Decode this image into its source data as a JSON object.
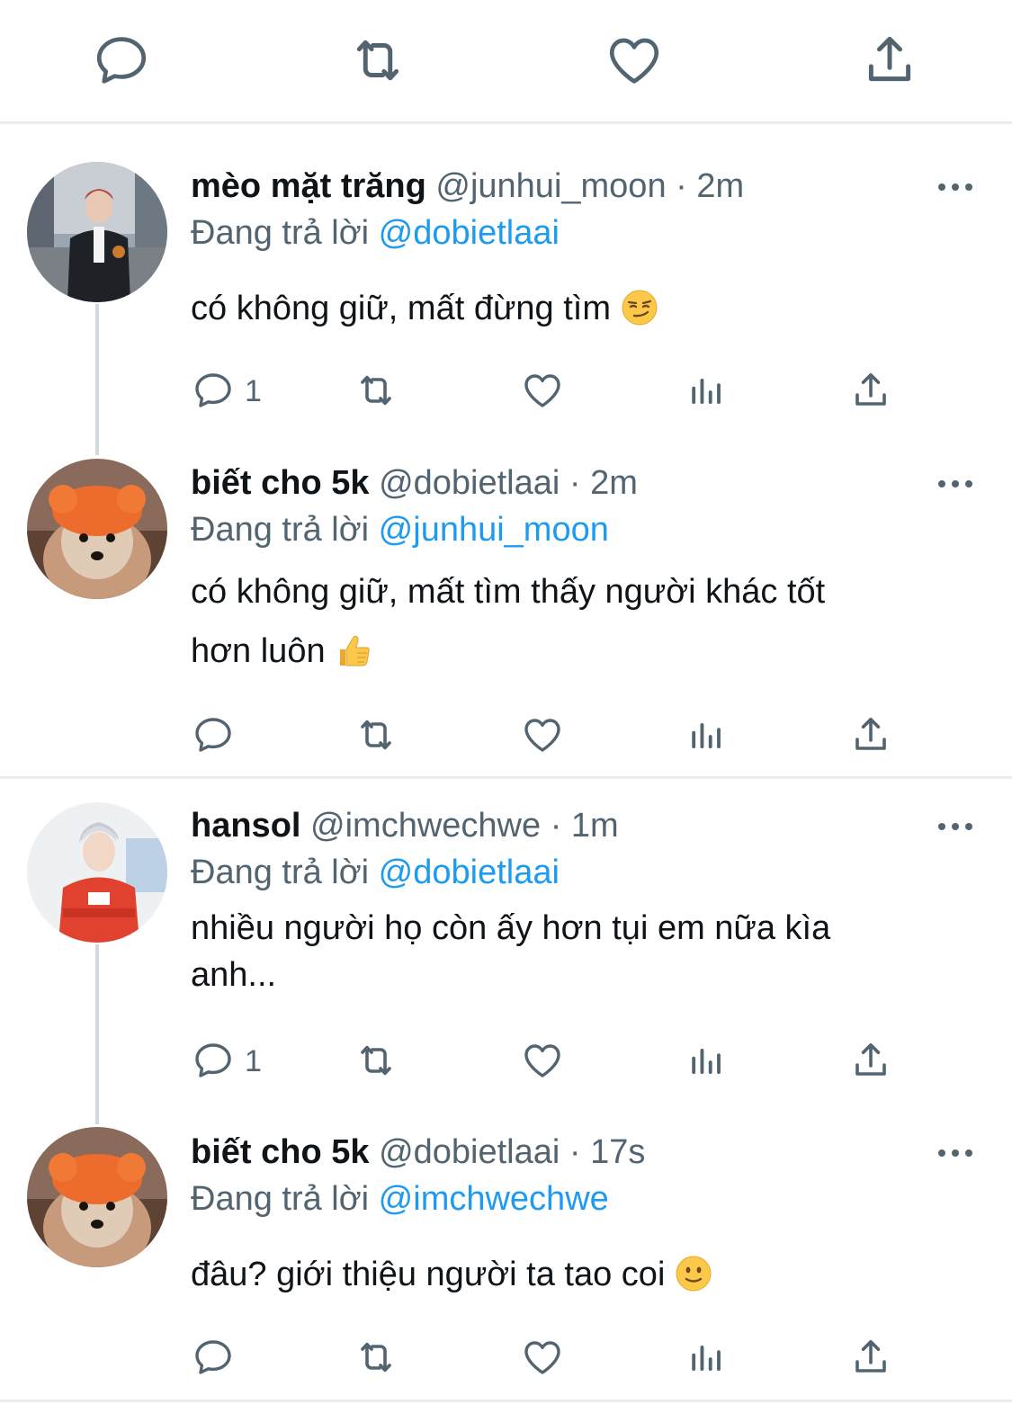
{
  "top_actions": [
    "reply-icon",
    "retweet-icon",
    "like-icon",
    "share-icon"
  ],
  "tweets": [
    {
      "name": "mèo mặt trăng",
      "handle": "@junhui_moon",
      "sep": "·",
      "time": "2m",
      "reply_prefix": "Đang trả lời",
      "reply_to": "@dobietlaai",
      "text": "có không giữ, mất đừng tìm",
      "emoji": "smirk",
      "reply_count": "1"
    },
    {
      "name": "biết cho 5k",
      "handle": "@dobietlaai",
      "sep": "·",
      "time": "2m",
      "reply_prefix": "Đang trả lời",
      "reply_to": "@junhui_moon",
      "text_line1": "có không giữ, mất tìm thấy người khác tốt",
      "text_line2": "hơn luôn",
      "emoji": "thumbs-up",
      "reply_count": ""
    },
    {
      "name": "hansol",
      "handle": "@imchwechwe",
      "sep": "·",
      "time": "1m",
      "reply_prefix": "Đang trả lời",
      "reply_to": "@dobietlaai",
      "text_line1": "nhiều người họ còn ấy hơn tụi em nữa kìa",
      "text_line2": "anh...",
      "reply_count": "1"
    },
    {
      "name": "biết cho 5k",
      "handle": "@dobietlaai",
      "sep": "·",
      "time": "17s",
      "reply_prefix": "Đang trả lời",
      "reply_to": "@imchwechwe",
      "text": "đâu? giới thiệu người ta tao coi",
      "emoji": "slight-smile",
      "reply_count": ""
    }
  ],
  "colors": {
    "link": "#1d9bf0",
    "secondary_text": "#536471",
    "divider": "#e9ecee"
  }
}
